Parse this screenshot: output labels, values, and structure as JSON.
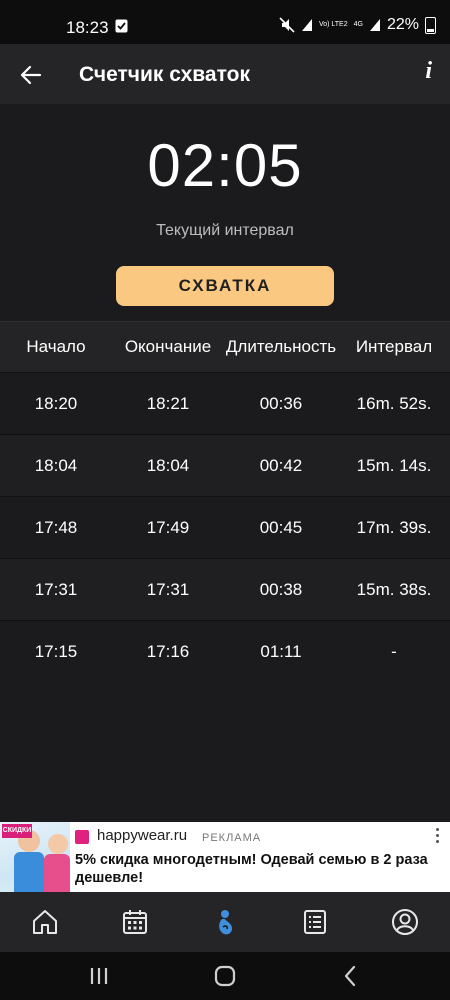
{
  "status_bar": {
    "time": "18:23",
    "network": "Vo) LTE2",
    "signal_type": "4G",
    "battery": "22%"
  },
  "toolbar": {
    "title": "Счетчик схваток",
    "info": "i"
  },
  "timer": {
    "value": "02:05",
    "label": "Текущий интервал"
  },
  "action_button": "СХВАТКА",
  "table": {
    "headers": [
      "Начало",
      "Окончание",
      "Длительность",
      "Интервал"
    ],
    "rows": [
      [
        "18:20",
        "18:21",
        "00:36",
        "16m. 52s."
      ],
      [
        "18:04",
        "18:04",
        "00:42",
        "15m. 14s."
      ],
      [
        "17:48",
        "17:49",
        "00:45",
        "17m. 39s."
      ],
      [
        "17:31",
        "17:31",
        "00:38",
        "15m. 38s."
      ],
      [
        "17:15",
        "17:16",
        "01:11",
        "-"
      ]
    ]
  },
  "ad": {
    "site": "happywear.ru",
    "label": "РЕКЛАМА",
    "text": "5% скидка многодетным! Одевай семью в 2 раза дешевле!",
    "image_badge": "СКИДКИ"
  },
  "bottom_nav": {
    "items": [
      "home-icon",
      "calendar-icon",
      "contraction-counter-icon",
      "list-icon",
      "profile-icon"
    ],
    "active_index": 2,
    "active_color": "#3f8fdc"
  },
  "colors": {
    "background": "#1b1b1d",
    "accent_button": "#fbc881"
  }
}
